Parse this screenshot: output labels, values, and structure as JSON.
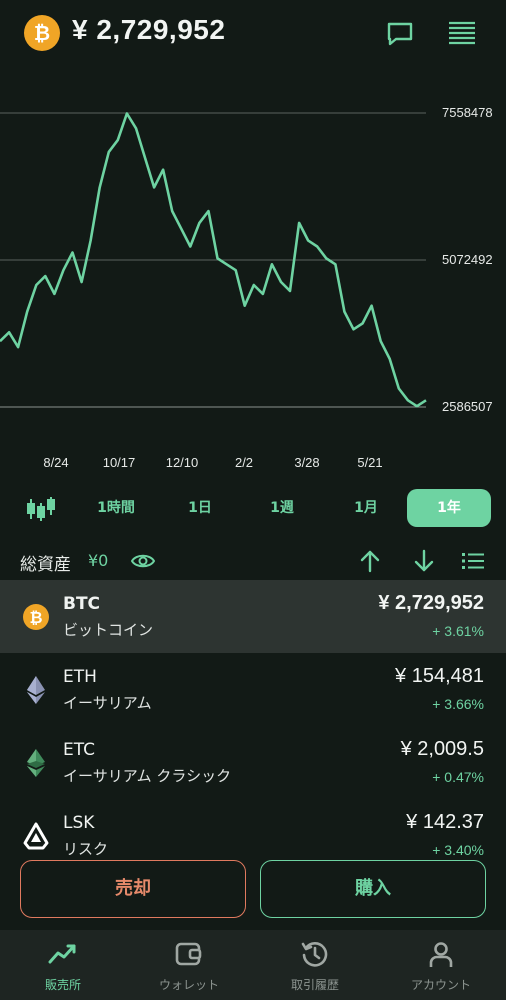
{
  "header": {
    "btc_logo": "₿",
    "price": "¥ 2,729,952",
    "icons": [
      "chat-icon",
      "menu-icon"
    ]
  },
  "chart_data": {
    "type": "line",
    "y_ticks": [
      "7558478",
      "5072492",
      "2586507"
    ],
    "x_ticks": [
      "8/24",
      "10/17",
      "12/10",
      "2/2",
      "3/28",
      "5/21"
    ],
    "ylim": [
      2586507,
      7558478
    ],
    "grid": true,
    "color": "#6ed3a2",
    "values": [
      3700000,
      3850000,
      3600000,
      4200000,
      4650000,
      4800000,
      4500000,
      4900000,
      5200000,
      4700000,
      5400000,
      6300000,
      6900000,
      7100000,
      7550000,
      7300000,
      6800000,
      6300000,
      6600000,
      5900000,
      5600000,
      5300000,
      5700000,
      5900000,
      5100000,
      5000000,
      4900000,
      4300000,
      4650000,
      4500000,
      5000000,
      4700000,
      4550000,
      5700000,
      5400000,
      5300000,
      5100000,
      5000000,
      4200000,
      3900000,
      4000000,
      4300000,
      3700000,
      3400000,
      2900000,
      2700000,
      2600000,
      2700000
    ]
  },
  "periods": {
    "candle_icon": "candlestick-icon",
    "items": [
      "1時間",
      "1日",
      "1週",
      "1月",
      "1年"
    ],
    "active": "1年"
  },
  "assets": {
    "label": "総資産",
    "value": "¥0"
  },
  "coins": [
    {
      "symbol": "BTC",
      "name": "ビットコイン",
      "price": "¥ 2,729,952",
      "change": "+ 3.61%",
      "icon": "bitcoin-icon"
    },
    {
      "symbol": "ETH",
      "name": "イーサリアム",
      "price": "¥ 154,481",
      "change": "+ 3.66%",
      "icon": "ethereum-icon"
    },
    {
      "symbol": "ETC",
      "name": "イーサリアム クラシック",
      "price": "¥ 2,009.5",
      "change": "+ 0.47%",
      "icon": "ethereum-classic-icon"
    },
    {
      "symbol": "LSK",
      "name": "リスク",
      "price": "¥ 142.37",
      "change": "+ 3.40%",
      "icon": "lisk-icon"
    }
  ],
  "actions": {
    "sell": "売却",
    "buy": "購入"
  },
  "tabs": [
    {
      "label": "販売所",
      "icon": "chart-trend-icon"
    },
    {
      "label": "ウォレット",
      "icon": "wallet-icon"
    },
    {
      "label": "取引履歴",
      "icon": "history-icon"
    },
    {
      "label": "アカウント",
      "icon": "account-icon"
    }
  ],
  "colors": {
    "accent": "#6ed3a2",
    "sell": "#e07a5f",
    "background": "#121a16",
    "btc": "#f0a526"
  }
}
